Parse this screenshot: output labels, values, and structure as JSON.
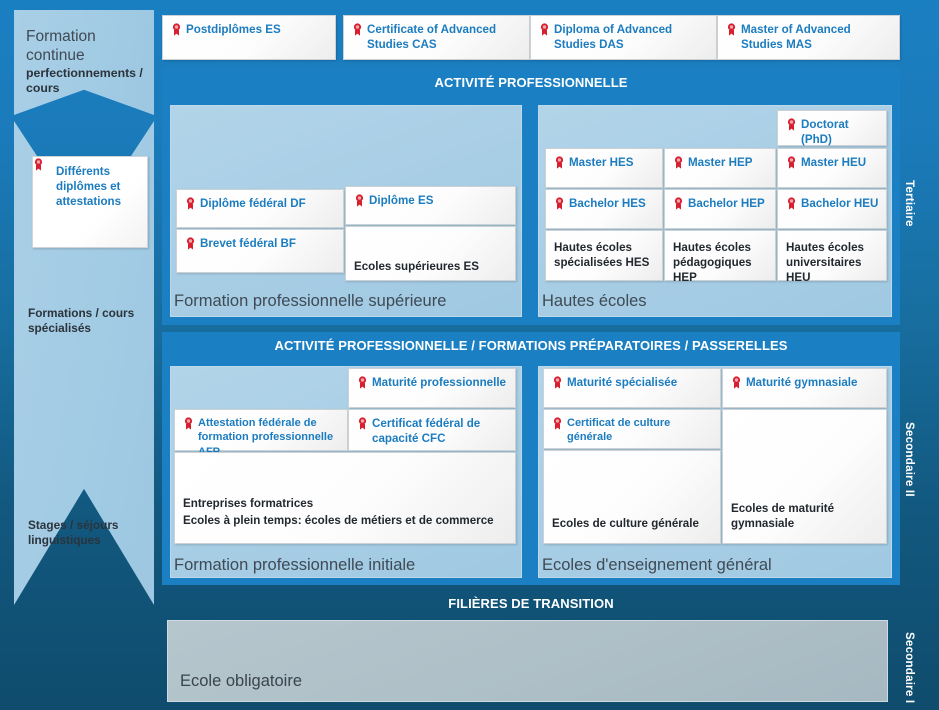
{
  "sidebar": {
    "title_line1": "Formation continue",
    "title_line2": "perfectionnements / cours",
    "card_label": "Différents diplômes et attestations",
    "note_1": "Formations / cours spécialisés",
    "note_2": "Stages / séjours linguistiques"
  },
  "top_row": [
    {
      "label": "Postdiplômes ES",
      "icon": "award-badge-icon"
    },
    {
      "label": "Certificate of Advanced Studies CAS",
      "icon": "award-badge-icon"
    },
    {
      "label": "Diploma of Advanced Studies DAS",
      "icon": "award-badge-icon"
    },
    {
      "label": "Master of Advanced Studies MAS",
      "icon": "award-badge-icon"
    }
  ],
  "banners": {
    "tertiary": "ACTIVITÉ PROFESSIONNELLE",
    "secondary2": "ACTIVITÉ PROFESSIONNELLE / FORMATIONS PRÉPARATOIRES / PASSERELLES",
    "transition": "FILIÈRES DE TRANSITION"
  },
  "levels": {
    "tertiary": "Tertiaire",
    "secondary2": "Secondaire II",
    "secondary1": "Secondaire I"
  },
  "tertiary": {
    "vocational": {
      "panel_label": "Formation professionnelle supérieure",
      "diplome_federal": "Diplôme fédéral DF",
      "brevet_federal": "Brevet fédéral BF",
      "diplome_es": "Diplôme ES",
      "ecoles_superieures": "Ecoles supérieures ES"
    },
    "higher_ed": {
      "panel_label": "Hautes écoles",
      "doctorat": "Doctorat (PhD)",
      "columns": [
        {
          "master": "Master HES",
          "bachelor": "Bachelor HES",
          "institution": "Hautes écoles spécialisées HES"
        },
        {
          "master": "Master HEP",
          "bachelor": "Bachelor HEP",
          "institution": "Hautes écoles pédagogiques HEP"
        },
        {
          "master": "Master HEU",
          "bachelor": "Bachelor HEU",
          "institution": "Hautes écoles universitaires HEU"
        }
      ]
    }
  },
  "secondary2": {
    "vocational": {
      "panel_label": "Formation professionnelle initiale",
      "maturite_prof": "Maturité professionnelle",
      "afp": "Attestation fédérale de formation professionnelle AFP",
      "cfc": "Certificat fédéral de capacité CFC",
      "institution_line1": "Entreprises formatrices",
      "institution_line2": "Ecoles à plein temps: écoles de métiers et de commerce"
    },
    "general": {
      "panel_label": "Ecoles d'enseignement général",
      "maturite_specialisee": "Maturité spécialisée",
      "maturite_gymnasiale": "Maturité gymnasiale",
      "certificat_culture": "Certificat de culture générale",
      "ecoles_culture": "Ecoles de culture générale",
      "ecoles_maturite": "Ecoles de maturité gymnasiale"
    }
  },
  "secondary1": {
    "label": "Ecole obligatoire"
  },
  "colors": {
    "accent_blue": "#1b80c3",
    "cert_text": "#1b7cc0",
    "badge_red": "#d81f30",
    "panel_blue": "#a8cee5",
    "dark_text": "#3f4a54"
  }
}
